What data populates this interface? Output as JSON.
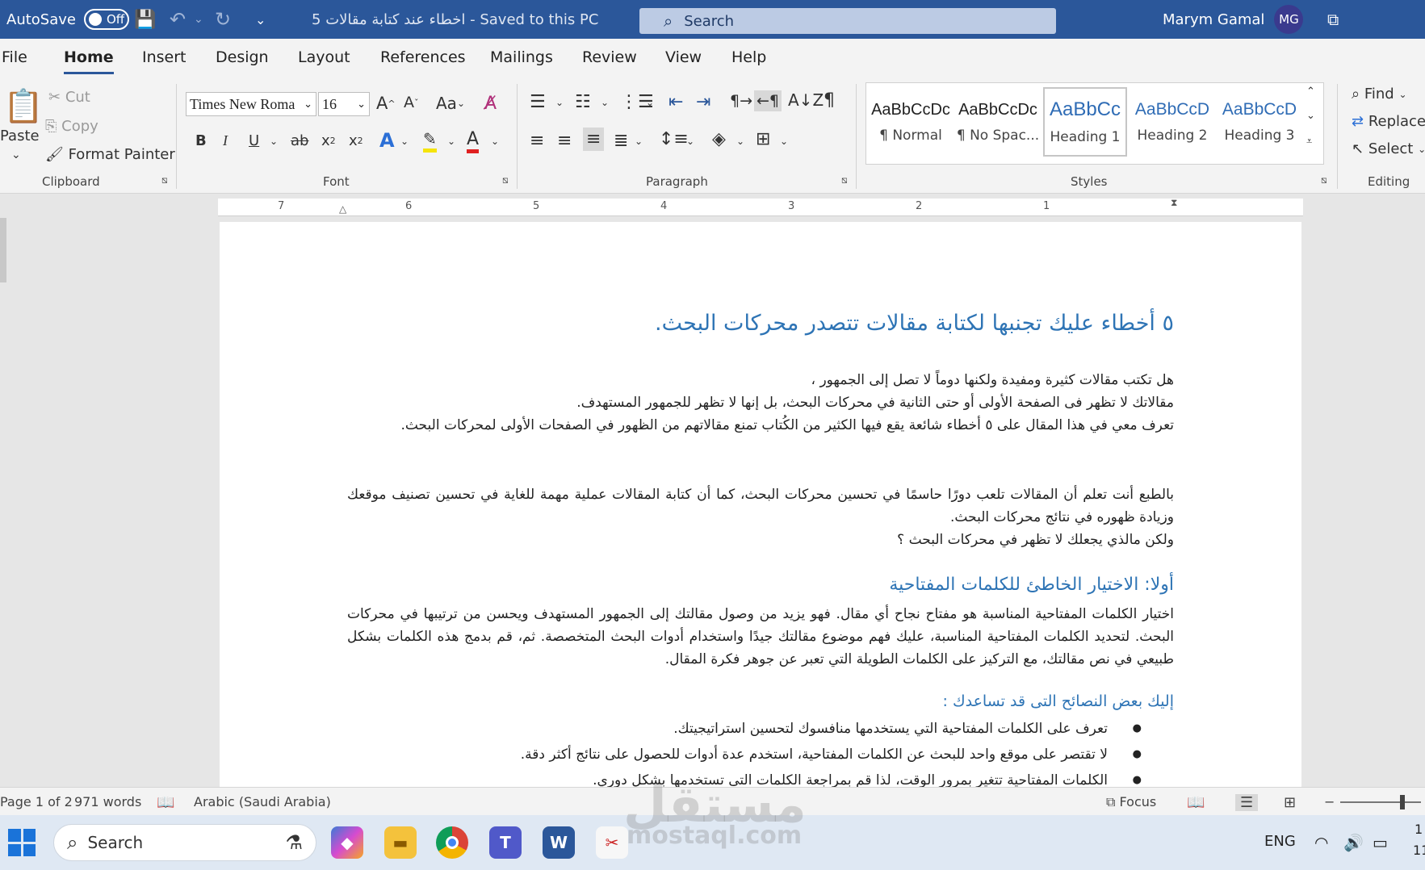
{
  "titlebar": {
    "autosave_label": "AutoSave",
    "autosave_state": "Off",
    "doc_title": "5 اخطاء عند كتابة مقالات  -  Saved to this PC",
    "search_placeholder": "Search",
    "user_name": "Marym Gamal",
    "user_initials": "MG"
  },
  "tabs": [
    "File",
    "Home",
    "Insert",
    "Design",
    "Layout",
    "References",
    "Mailings",
    "Review",
    "View",
    "Help"
  ],
  "clipboard": {
    "paste": "Paste",
    "cut": "Cut",
    "copy": "Copy",
    "format_painter": "Format Painter",
    "label": "Clipboard"
  },
  "font": {
    "name": "Times New Roma",
    "size": "16",
    "case": "Aa",
    "label": "Font"
  },
  "paragraph": {
    "label": "Paragraph"
  },
  "styles": {
    "label": "Styles",
    "items": [
      {
        "sample": "AaBbCcDc",
        "name": "¶ Normal"
      },
      {
        "sample": "AaBbCcDc",
        "name": "¶ No Spac..."
      },
      {
        "sample": "AaBbCc",
        "name": "Heading 1"
      },
      {
        "sample": "AaBbCcD",
        "name": "Heading 2"
      },
      {
        "sample": "AaBbCcD",
        "name": "Heading 3"
      }
    ]
  },
  "editing": {
    "find": "Find",
    "replace": "Replace",
    "select": "Select",
    "label": "Editing"
  },
  "ruler": [
    "7",
    "6",
    "5",
    "4",
    "3",
    "2",
    "1"
  ],
  "document": {
    "title": "٥ أخطاء عليك تجنبها لكتابة مقالات تتصدر محركات البحث.",
    "intro": [
      "هل تكتب مقالات كثيرة ومفيدة ولكنها دوماً لا تصل إلى الجمهور ،",
      "مقالاتك لا تظهر فى الصفحة الأولى أو حتى الثانية في محركات البحث، بل إنها لا تظهر للجمهور المستهدف.",
      "تعرف معي في هذا المقال على ٥ أخطاء شائعة يقع فيها الكثير من الكُتاب تمنع مقالاتهم من الظهور في الصفحات الأولى لمحركات البحث."
    ],
    "para2": [
      "بالطبع أنت تعلم أن المقالات تلعب دورًا حاسمًا في تحسين محركات البحث، كما أن كتابة المقالات عملية مهمة للغاية في تحسين تصنيف موقعك وزيادة ظهوره في نتائج محركات البحث.",
      "ولكن مالذي يجعلك لا تظهر في محركات البحث ؟"
    ],
    "h2": "أولا: الاختيار الخاطئ للكلمات المفتاحية",
    "para3": "اختيار الكلمات المفتاحية المناسبة هو مفتاح نجاح أي مقال. فهو يزيد من وصول مقالتك إلى الجمهور المستهدف ويحسن من ترتيبها في محركات البحث. لتحديد الكلمات المفتاحية المناسبة، عليك فهم موضوع مقالتك جيدًا واستخدام أدوات البحث المتخصصة. ثم، قم بدمج هذه الكلمات بشكل طبيعي في نص مقالتك، مع التركيز على الكلمات الطويلة التي تعبر عن جوهر فكرة المقال.",
    "h3": "إليك بعض النصائح التى قد تساعدك :",
    "bullets": [
      "تعرف على الكلمات المفتاحية التي يستخدمها منافسوك لتحسين استراتيجيتك.",
      "لا تقتصر على موقع واحد للبحث عن الكلمات المفتاحية، استخدم عدة أدوات للحصول على نتائج أكثر دقة.",
      "الكلمات المفتاحية تتغير بمرور الوقت، لذا قم بمراجعة الكلمات التي تستخدمها بشكل دوري."
    ]
  },
  "statusbar": {
    "page": "Page 1 of 2",
    "words": "971 words",
    "language": "Arabic (Saudi Arabia)",
    "focus": "Focus"
  },
  "taskbar": {
    "search_placeholder": "Search",
    "lang": "ENG",
    "clock_line1": "1",
    "clock_line2": "11"
  },
  "watermark": {
    "brand_ar": "مستقل",
    "brand_en": "mostaql.com"
  },
  "colors": {
    "titlebar": "#2b579a",
    "heading": "#2e74b5"
  }
}
